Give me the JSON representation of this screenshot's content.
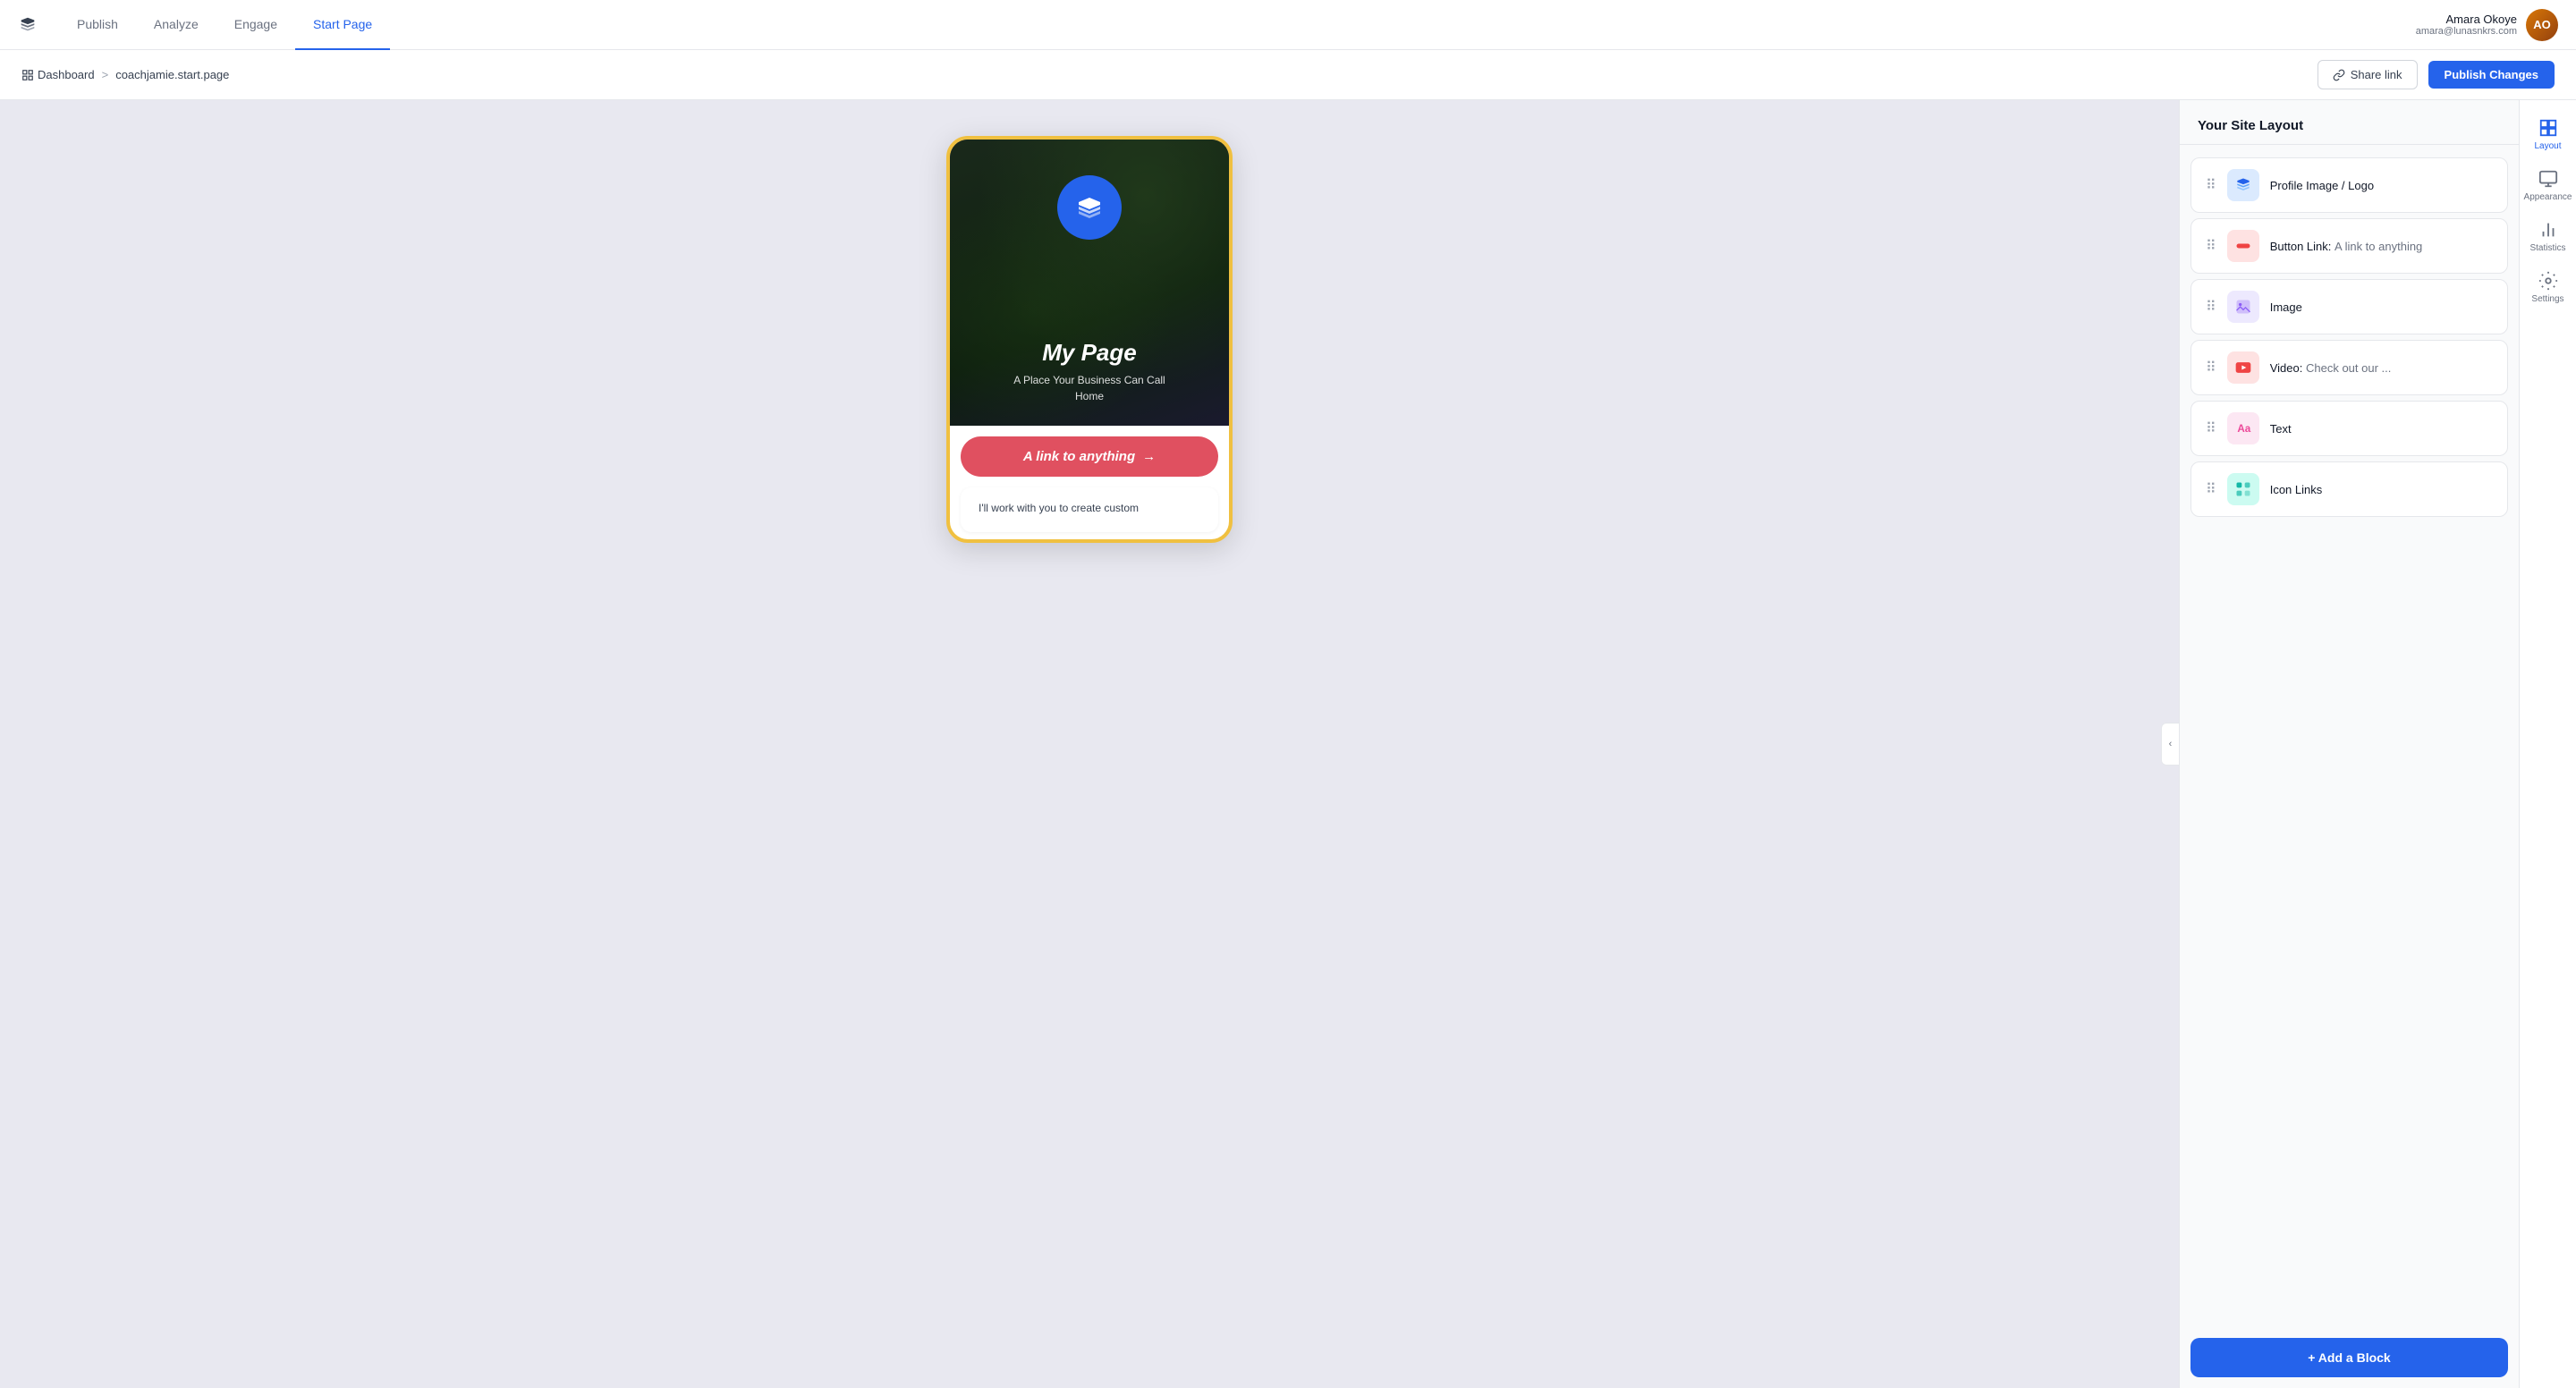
{
  "nav": {
    "logo_label": "Buffer",
    "tabs": [
      {
        "id": "publish",
        "label": "Publish",
        "active": false
      },
      {
        "id": "analyze",
        "label": "Analyze",
        "active": false
      },
      {
        "id": "engage",
        "label": "Engage",
        "active": false
      },
      {
        "id": "startpage",
        "label": "Start Page",
        "active": true
      }
    ],
    "user": {
      "name": "Amara Okoye",
      "email": "amara@lunasnkrs.com",
      "initials": "AO"
    }
  },
  "subheader": {
    "breadcrumb_home": "Dashboard",
    "breadcrumb_sep": ">",
    "breadcrumb_current": "coachjamie.start.page",
    "share_label": "Share link",
    "publish_label": "Publish Changes"
  },
  "canvas": {
    "phone": {
      "title": "My Page",
      "subtitle_line1": "A Place Your Business Can Call",
      "subtitle_line2": "Home",
      "button_label": "A link to anything",
      "text_block": "I'll work with you to create custom"
    }
  },
  "layout_panel": {
    "title": "Your Site Layout",
    "items": [
      {
        "id": "profile",
        "label": "Profile Image / Logo",
        "sublabel": "",
        "icon_type": "blue"
      },
      {
        "id": "button_link",
        "label": "Button Link:",
        "sublabel": "A link to anything",
        "icon_type": "red"
      },
      {
        "id": "image",
        "label": "Image",
        "sublabel": "",
        "icon_type": "purple"
      },
      {
        "id": "video",
        "label": "Video:",
        "sublabel": "Check out our ...",
        "icon_type": "video"
      },
      {
        "id": "text",
        "label": "Text",
        "sublabel": "",
        "icon_type": "text-icon"
      },
      {
        "id": "icon_links",
        "label": "Icon Links",
        "sublabel": "",
        "icon_type": "teal"
      }
    ],
    "add_block_label": "+ Add a Block"
  },
  "sidebar_icons": [
    {
      "id": "layout",
      "label": "Layout",
      "active": true
    },
    {
      "id": "appearance",
      "label": "Appearance",
      "active": false
    },
    {
      "id": "statistics",
      "label": "Statistics",
      "active": false
    },
    {
      "id": "settings",
      "label": "Settings",
      "active": false
    }
  ]
}
